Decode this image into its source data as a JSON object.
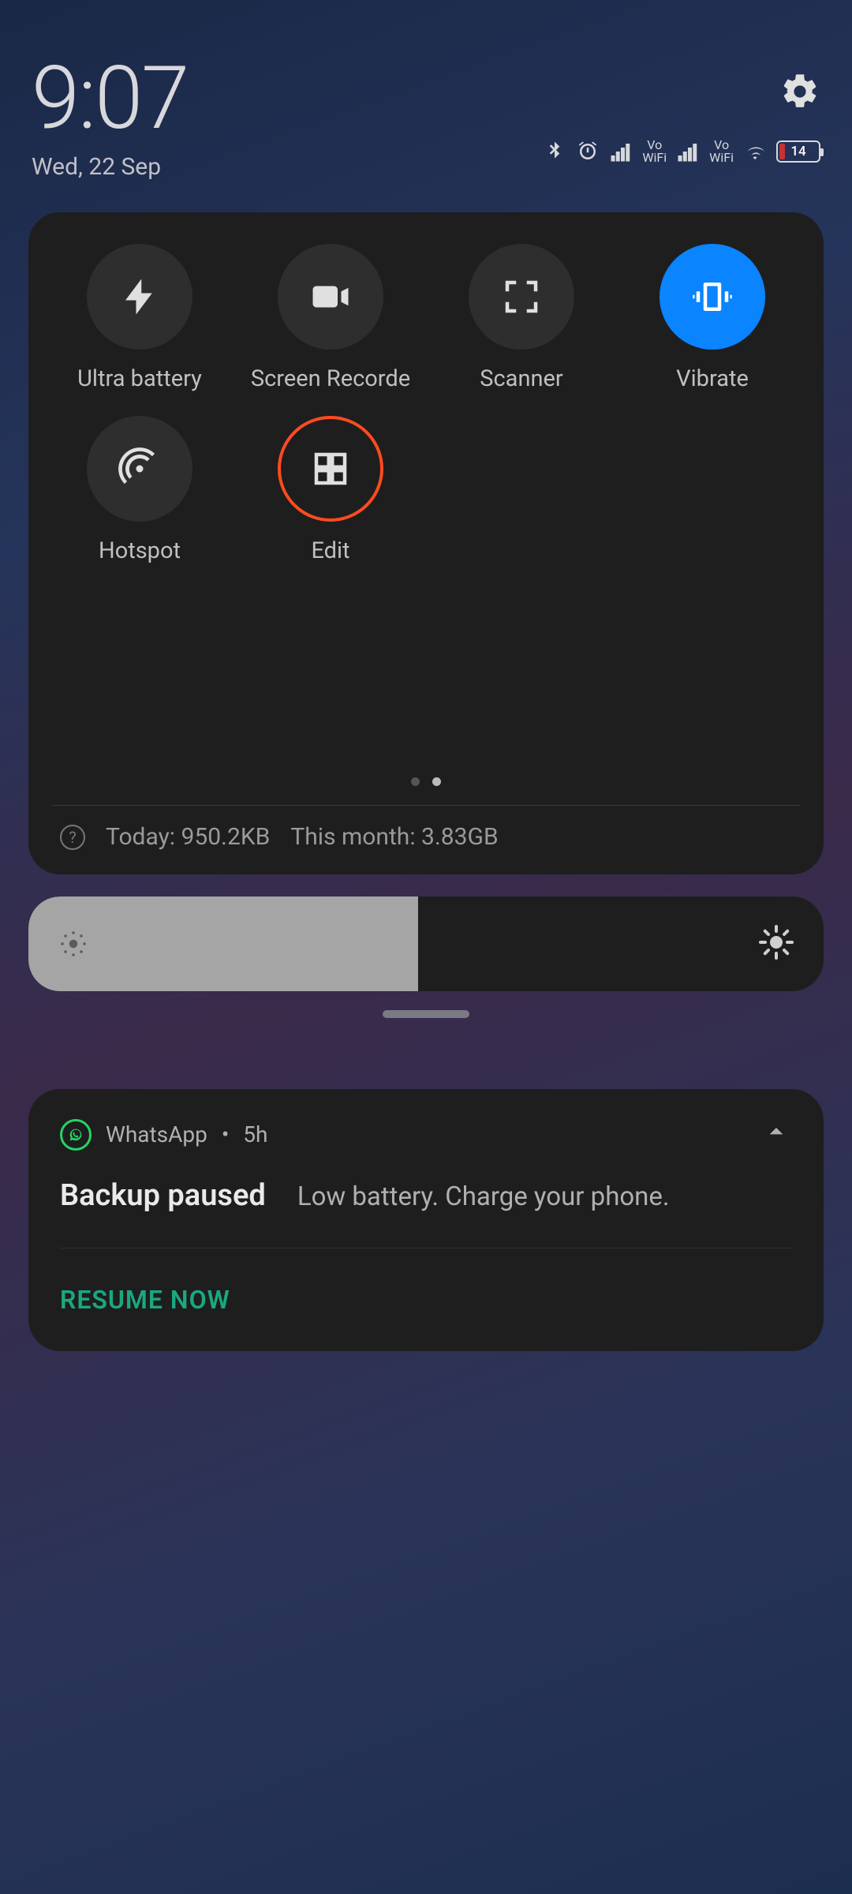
{
  "header": {
    "time": "9:07",
    "date": "Wed, 22 Sep",
    "battery_percent": "14"
  },
  "qs": {
    "tiles": [
      {
        "label": "Ultra battery"
      },
      {
        "label": "Screen Recorde"
      },
      {
        "label": "Scanner"
      },
      {
        "label": "Vibrate"
      },
      {
        "label": "Hotspot"
      },
      {
        "label": "Edit"
      }
    ]
  },
  "data_usage": {
    "today": "Today: 950.2KB",
    "month": "This month: 3.83GB"
  },
  "brightness": {
    "percent": 49
  },
  "notification": {
    "app": "WhatsApp",
    "time": "5h",
    "title": "Backup paused",
    "text": "Low battery. Charge your phone.",
    "action": "RESUME NOW"
  }
}
